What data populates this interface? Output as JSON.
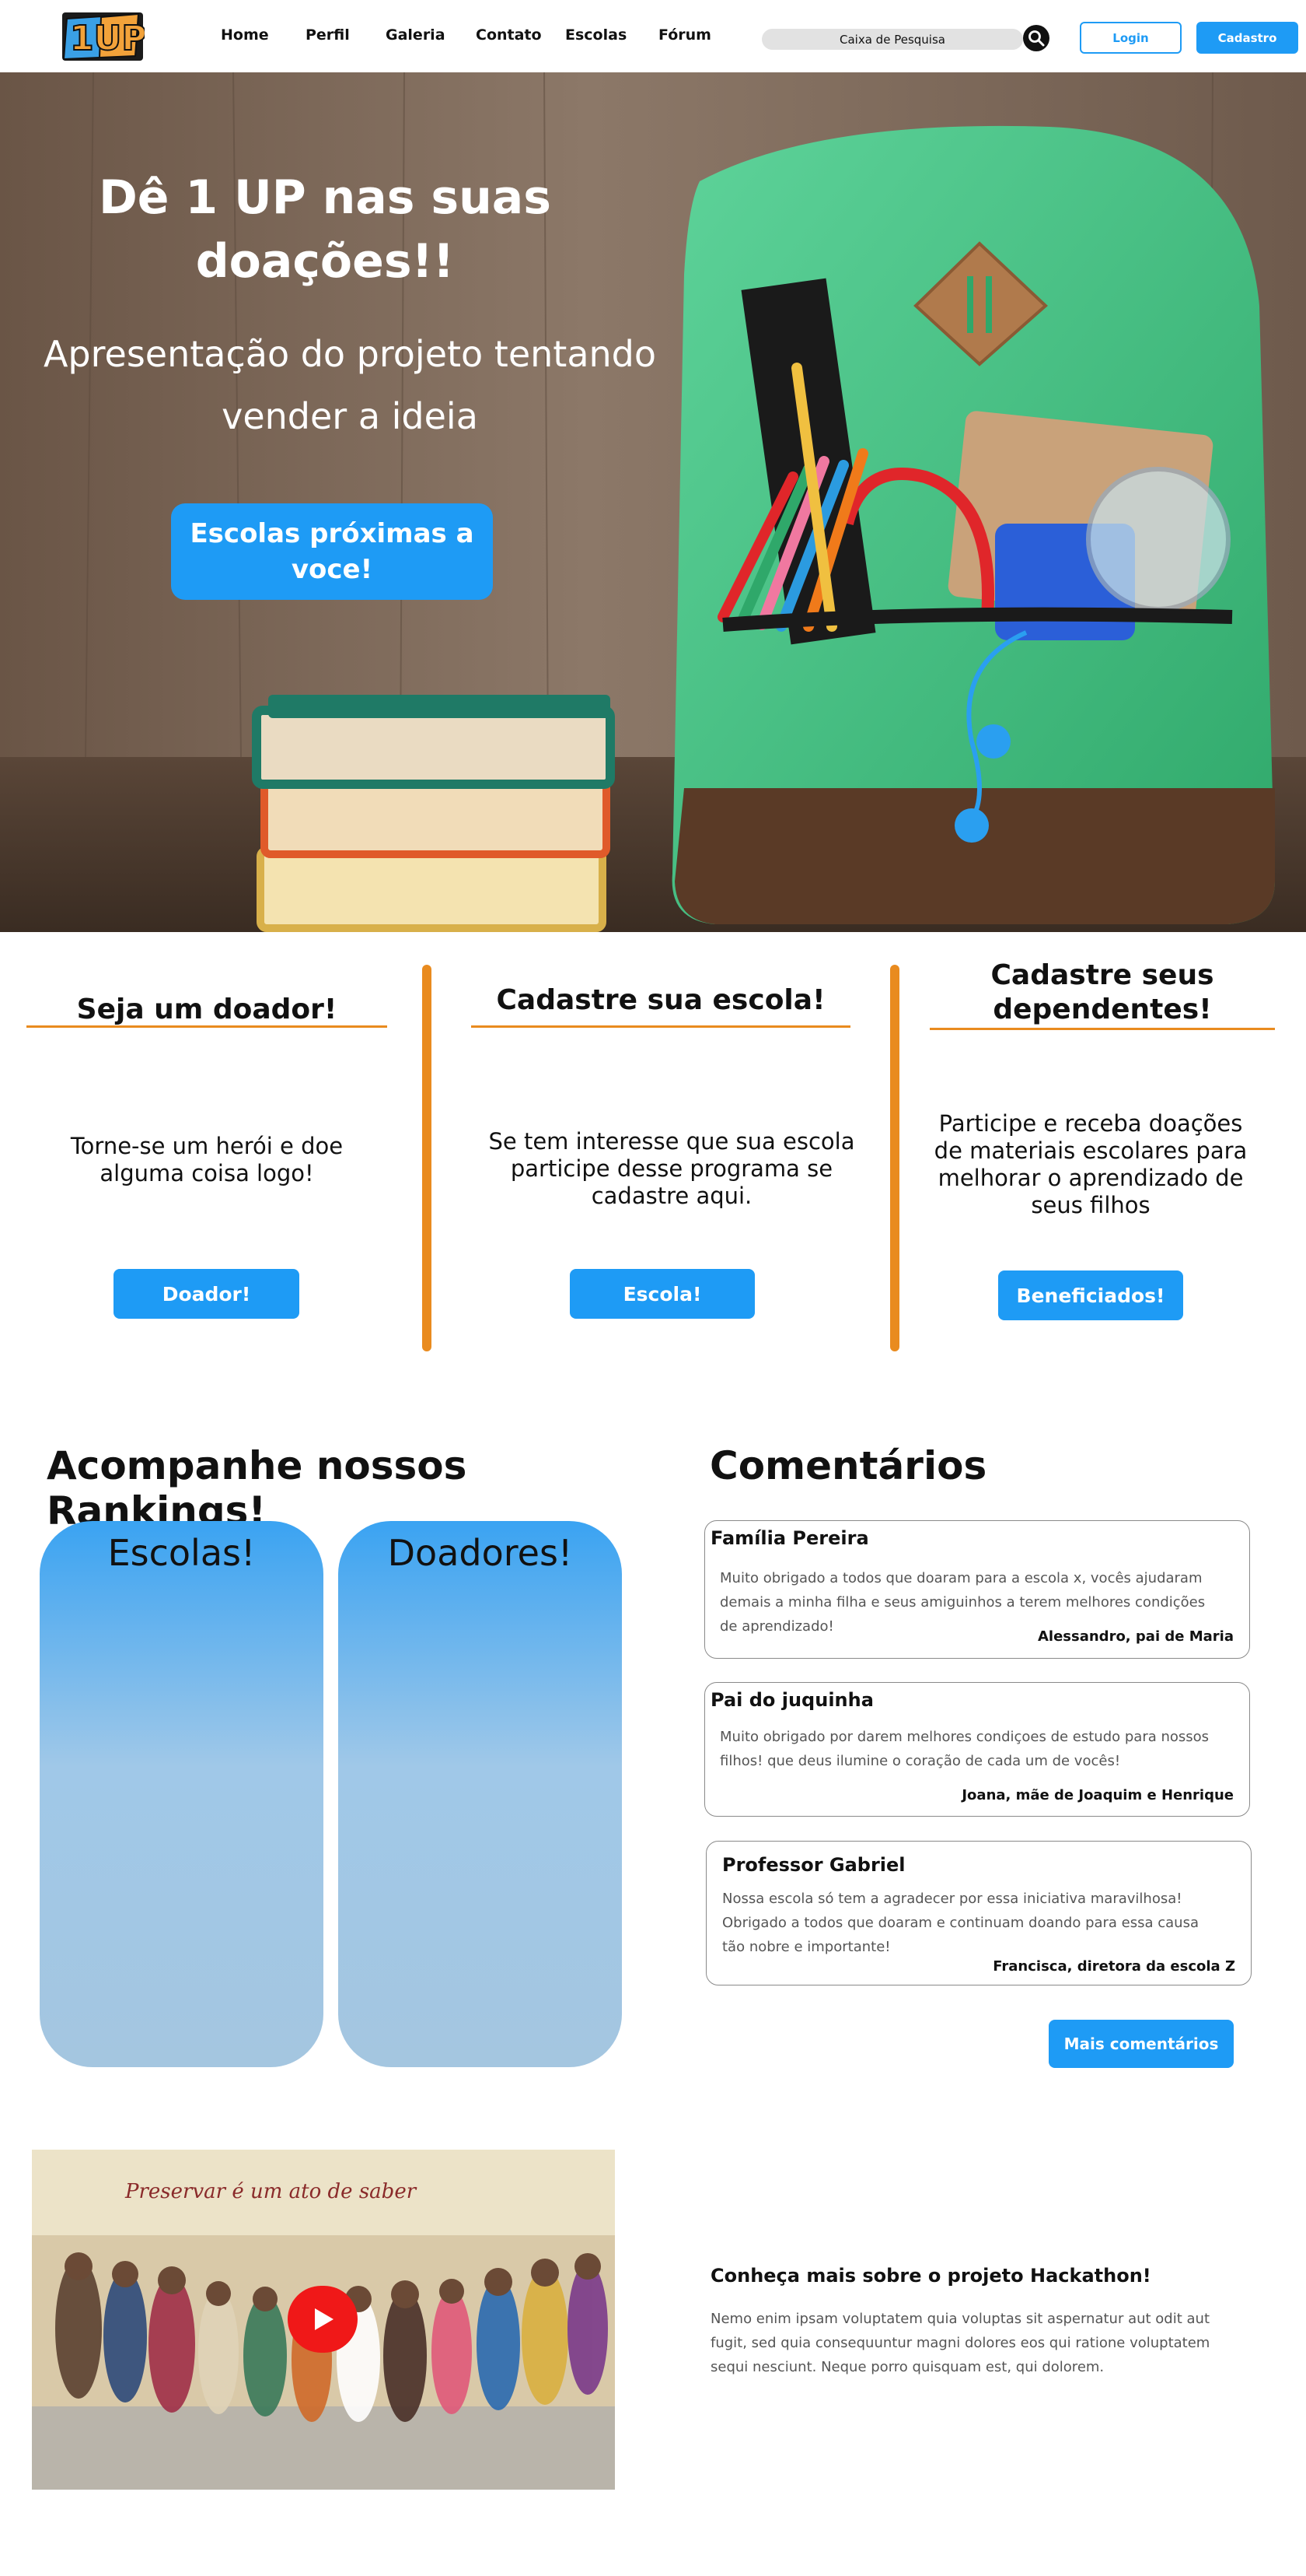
{
  "brand": {
    "logo_text": "1UP",
    "colors": {
      "primary": "#1e9bf5",
      "accent": "#e98b1f",
      "logo_blue": "#3aa0e6",
      "logo_orange": "#f2a23a"
    }
  },
  "nav": {
    "links": [
      "Home",
      "Perfil",
      "Galeria",
      "Contato",
      "Escolas",
      "Fórum"
    ],
    "search_placeholder": "Caixa de Pesquisa",
    "search_icon": "search-icon",
    "login_label": "Login",
    "signup_label": "Cadastro"
  },
  "hero": {
    "title": "Dê 1 UP nas suas doações!!",
    "subtitle": "Apresentação do projeto tentando vender a ideia",
    "cta_label": "Escolas próximas a voce!"
  },
  "cards": [
    {
      "title": "Seja um doador!",
      "text": "Torne-se um herói e doe alguma coisa logo!",
      "button": "Doador!"
    },
    {
      "title": "Cadastre sua escola!",
      "text": "Se tem interesse que sua escola participe desse programa se cadastre aqui.",
      "button": "Escola!"
    },
    {
      "title": "Cadastre seus dependentes!",
      "text": "Participe e receba doações de materiais escolares para melhorar o aprendizado de seus filhos",
      "button": "Beneficiados!"
    }
  ],
  "rankings": {
    "heading": "Acompanhe nossos Rankings!",
    "panels": [
      "Escolas!",
      "Doadores!"
    ]
  },
  "comments": {
    "heading": "Comentários",
    "items": [
      {
        "name": "Família Pereira",
        "body": "Muito obrigado a todos que doaram para a escola x,  vocês ajudaram demais a minha filha e seus amiguinhos a terem melhores condições de aprendizado!",
        "author": "Alessandro, pai de Maria"
      },
      {
        "name": "Pai do juquinha",
        "body": "Muito obrigado por darem melhores condiçoes de estudo para nossos filhos! que deus ilumine o coração de cada um de vocês!",
        "author": "Joana, mãe de Joaquim e Henrique"
      },
      {
        "name": "Professor Gabriel",
        "body": "Nossa escola só tem a agradecer por essa iniciativa maravilhosa! Obrigado a todos que doaram e continuam doando para essa causa tão nobre e importante!",
        "author": "Francisca, diretora da escola Z"
      }
    ],
    "more_label": "Mais comentários"
  },
  "video": {
    "banner_text": "Preservar é um ato de saber",
    "play_icon": "play-icon"
  },
  "about": {
    "title": "Conheça mais sobre o projeto Hackathon!",
    "text": "Nemo enim ipsam voluptatem quia voluptas sit aspernatur aut odit aut fugit, sed quia consequuntur magni dolores eos qui ratione voluptatem sequi nesciunt. Neque porro quisquam est, qui dolorem."
  }
}
